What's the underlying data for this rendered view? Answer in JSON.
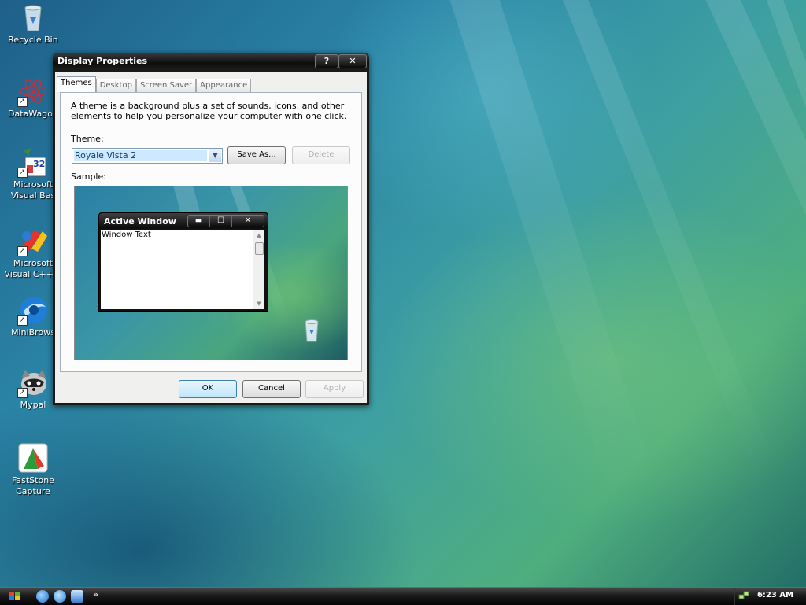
{
  "desktop": {
    "icons": [
      {
        "label": "Recycle Bin",
        "name": "recycle-bin-icon"
      },
      {
        "label": "DataWagon",
        "name": "datawagon-icon"
      },
      {
        "label": "Microsoft Visual Bas",
        "name": "vb-icon"
      },
      {
        "label": "Microsoft Visual C++",
        "name": "vcpp-icon"
      },
      {
        "label": "MiniBrows",
        "name": "minibrowser-icon"
      },
      {
        "label": "Mypal",
        "name": "mypal-icon"
      },
      {
        "label": "FastStone Capture",
        "name": "faststone-icon"
      }
    ],
    "vb_badge": "32"
  },
  "dialog": {
    "title": "Display Properties",
    "help_label": "?",
    "close_label": "✕",
    "tabs": [
      {
        "label": "Themes",
        "active": true
      },
      {
        "label": "Desktop",
        "active": false
      },
      {
        "label": "Screen Saver",
        "active": false
      },
      {
        "label": "Appearance",
        "active": false
      }
    ],
    "description": "A theme is a background plus a set of sounds, icons, and other elements to help you personalize your computer with one click.",
    "theme_label": "Theme:",
    "theme_value": "Royale Vista 2",
    "save_as_label": "Save As...",
    "delete_label": "Delete",
    "sample_label": "Sample:",
    "preview": {
      "window_title": "Active Window",
      "window_text": "Window Text",
      "min_label": "▬",
      "max_label": "☐",
      "close_label": "✕"
    },
    "ok_label": "OK",
    "cancel_label": "Cancel",
    "apply_label": "Apply"
  },
  "taskbar": {
    "chevron": "»",
    "clock": "6:23 AM"
  },
  "colors": {
    "titlebar": "#0d0d0d",
    "selection": "#cde8ff",
    "desktop_accent": "#2a84a6"
  }
}
